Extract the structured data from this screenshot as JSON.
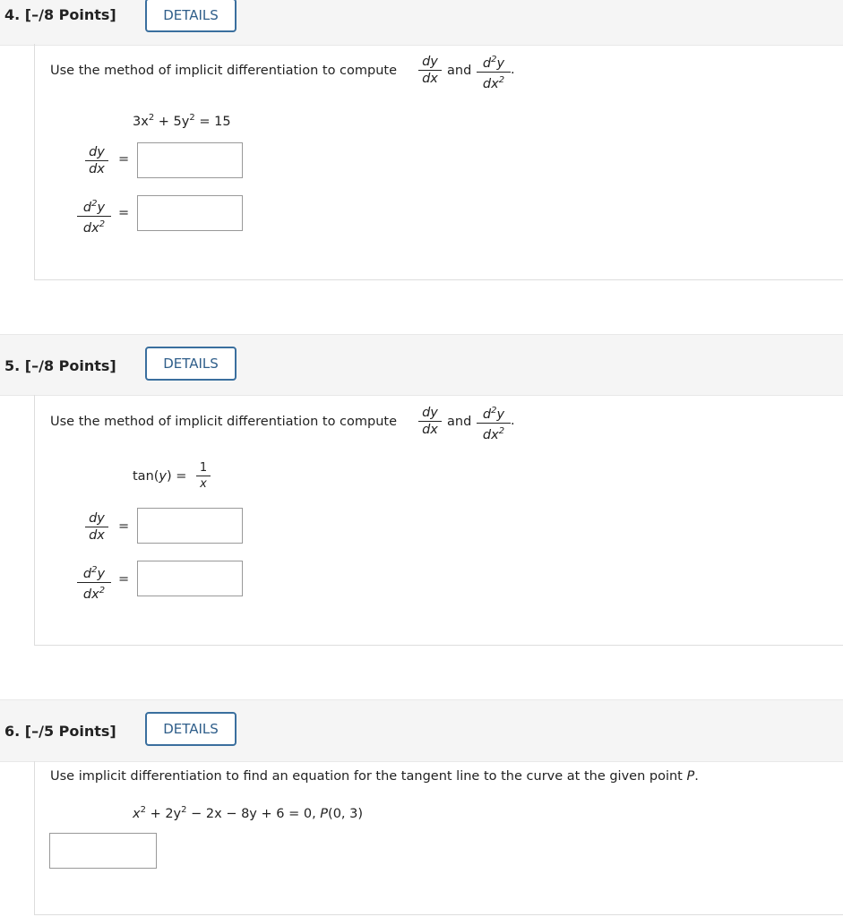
{
  "q4": {
    "title": "4. [–/8 Points]",
    "details": "DETAILS",
    "prompt": "Use the method of implicit differentiation to compute",
    "and": "and",
    "period": ".",
    "equation": {
      "a": "3x",
      "b": " + 5y",
      "c": " = 15"
    },
    "dy": "dy",
    "dx": "dx",
    "d2y": "d",
    "y": "y",
    "dxsq": "dx",
    "two": "2",
    "eq": "="
  },
  "q5": {
    "title": "5. [–/8 Points]",
    "details": "DETAILS",
    "prompt": "Use the method of implicit differentiation to compute",
    "and": "and",
    "period": ".",
    "equation": {
      "lhs": "tan(",
      "var": "y",
      "rhs": ") =",
      "num": "1",
      "den": "x"
    },
    "dy": "dy",
    "dx": "dx",
    "d2y": "d",
    "y": "y",
    "dxsq": "dx",
    "two": "2",
    "eq": "="
  },
  "q6": {
    "title": "6. [–/5 Points]",
    "details": "DETAILS",
    "prompt": "Use implicit differentiation to find an equation for the tangent line to the curve at the given point ",
    "prompt_point": "P",
    "prompt_end": ".",
    "equation": {
      "x": "x",
      "mid": " + 2y",
      "rest": " − 2x − 8y + 6 = 0, ",
      "P": "P",
      "pt": "(0, 3)",
      "two": "2"
    }
  }
}
